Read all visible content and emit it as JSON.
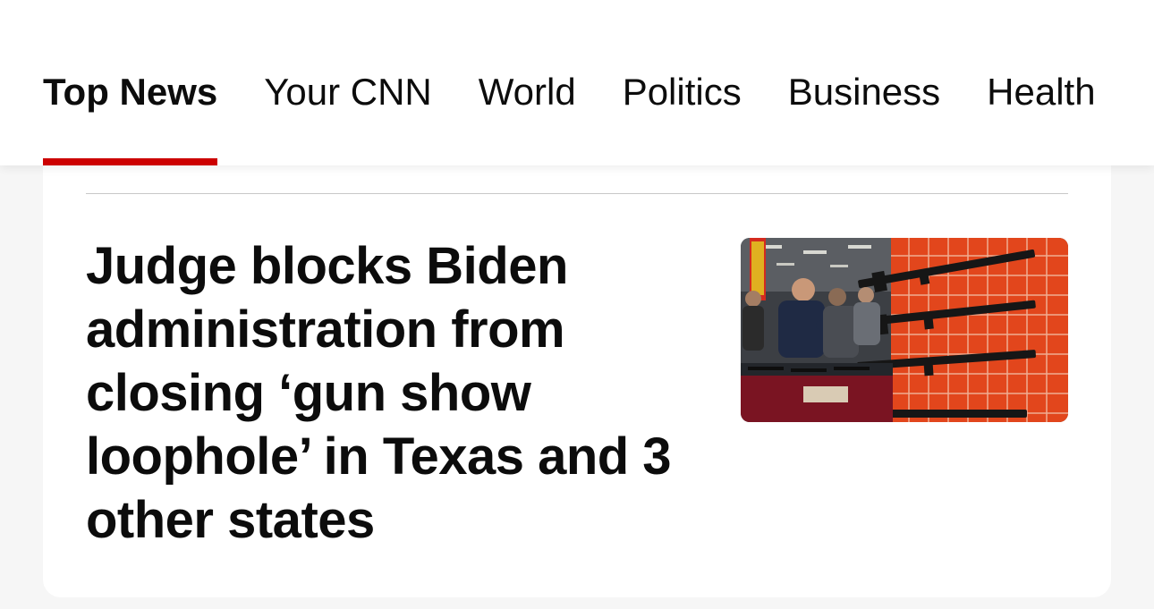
{
  "nav": {
    "tabs": [
      {
        "label": "Top News",
        "active": true
      },
      {
        "label": "Your CNN",
        "active": false
      },
      {
        "label": "World",
        "active": false
      },
      {
        "label": "Politics",
        "active": false
      },
      {
        "label": "Business",
        "active": false
      },
      {
        "label": "Health",
        "active": false
      }
    ],
    "active_color": "#cc0000"
  },
  "article": {
    "headline": "Judge blocks Biden administration from closing ‘gun show loophole’ in Texas and 3 other states",
    "thumbnail": "gun-show-photo"
  }
}
